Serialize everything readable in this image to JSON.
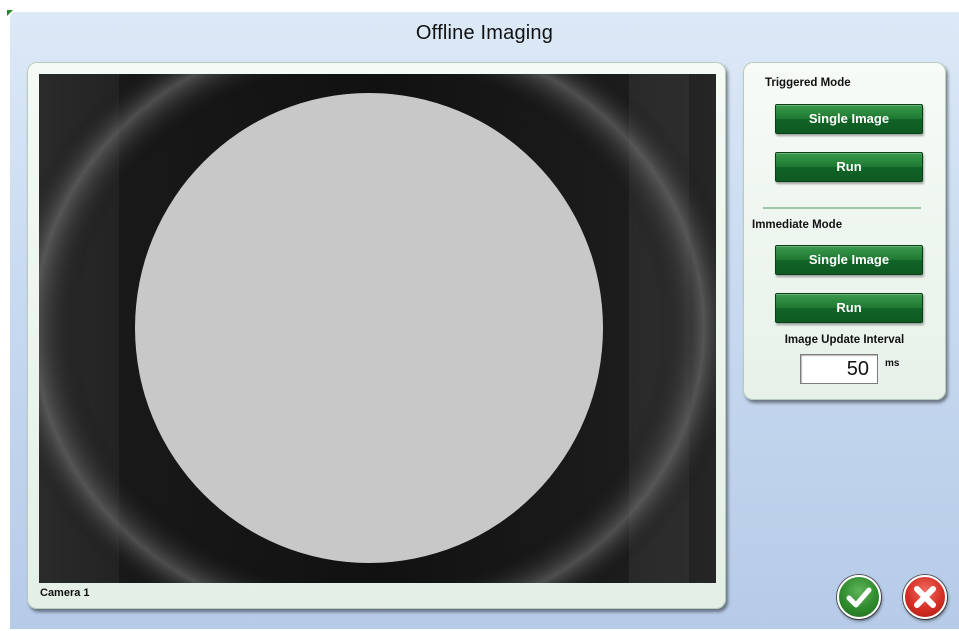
{
  "window": {
    "title": "Offline Imaging"
  },
  "viewer": {
    "camera_label": "Camera 1"
  },
  "triggered_mode": {
    "label": "Triggered Mode",
    "single_image_label": "Single Image",
    "run_label": "Run"
  },
  "immediate_mode": {
    "label": "Immediate Mode",
    "single_image_label": "Single Image",
    "run_label": "Run",
    "interval_label": "Image Update Interval",
    "interval_value": "50",
    "interval_unit": "ms"
  },
  "actions": {
    "ok_icon": "checkmark-icon",
    "cancel_icon": "x-icon"
  },
  "colors": {
    "button_green": "#1f7a33",
    "ok_green": "#2f8b2d",
    "cancel_red": "#d42f25",
    "background_blue": "#c8daf0"
  }
}
